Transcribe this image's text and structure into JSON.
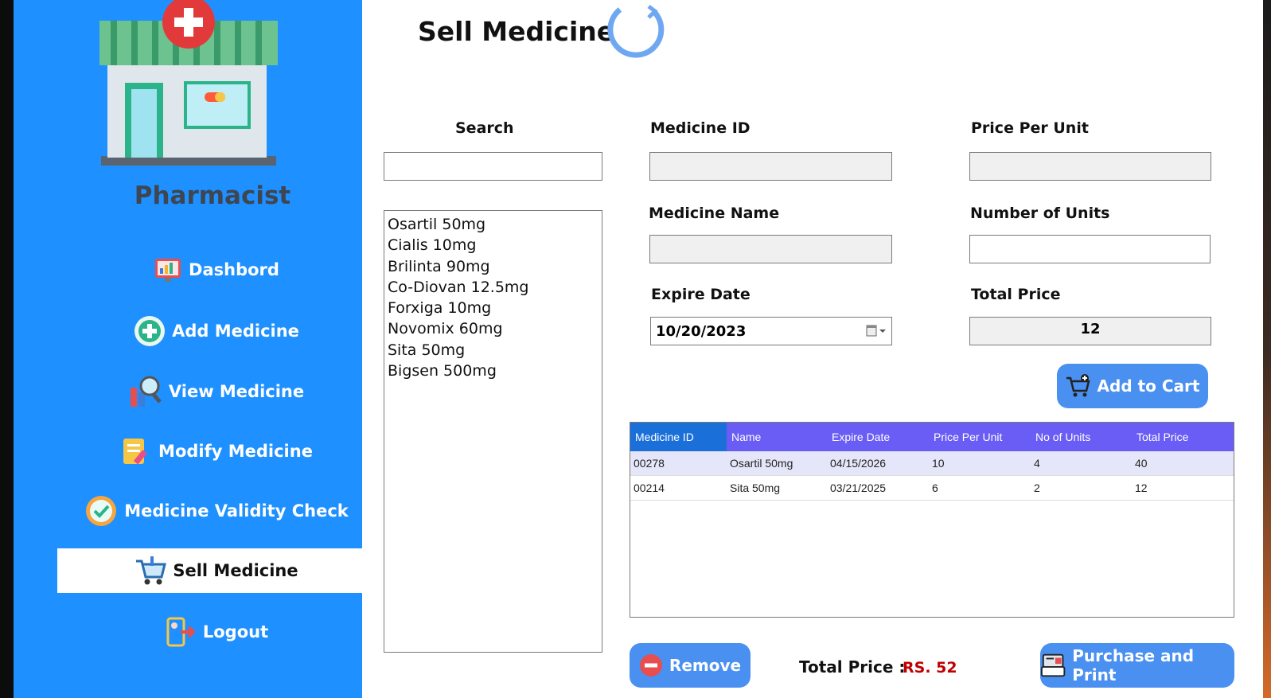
{
  "sidebar": {
    "brand": "Pharmacist",
    "items": [
      {
        "label": "Dashbord",
        "icon": "dashboard-icon"
      },
      {
        "label": "Add Medicine",
        "icon": "add-circle-icon"
      },
      {
        "label": "View Medicine",
        "icon": "magnifier-icon"
      },
      {
        "label": "Modify Medicine",
        "icon": "edit-note-icon"
      },
      {
        "label": "Medicine Validity Check",
        "icon": "check-badge-icon"
      },
      {
        "label": "Sell Medicine",
        "icon": "cart-icon"
      },
      {
        "label": "Logout",
        "icon": "logout-icon"
      }
    ]
  },
  "page": {
    "title": "Sell Medicine"
  },
  "search": {
    "label": "Search",
    "value": ""
  },
  "medicines": [
    "Osartil 50mg",
    "Cialis 10mg",
    "Brilinta 90mg",
    "Co-Diovan 12.5mg",
    "Forxiga 10mg",
    "Novomix 60mg",
    "Sita 50mg",
    "Bigsen 500mg"
  ],
  "form": {
    "medicine_id_label": "Medicine ID",
    "medicine_id": "",
    "price_per_unit_label": "Price Per Unit",
    "price_per_unit": "",
    "medicine_name_label": "Medicine Name",
    "medicine_name": "",
    "units_label": "Number of Units",
    "units": "",
    "expire_label": "Expire Date",
    "expire": "10/20/2023",
    "total_label": "Total Price",
    "total": "12"
  },
  "buttons": {
    "add_to_cart": "Add to Cart",
    "remove": "Remove",
    "purchase": "Purchase and Print"
  },
  "cart": {
    "columns": [
      "Medicine ID",
      "Name",
      "Expire Date",
      "Price Per Unit",
      "No of Units",
      "Total Price"
    ],
    "rows": [
      [
        "00278",
        "Osartil 50mg",
        "04/15/2026",
        "10",
        "4",
        "40"
      ],
      [
        "00214",
        "Sita 50mg",
        "03/21/2025",
        "6",
        "2",
        "12"
      ]
    ]
  },
  "footer": {
    "total_label": "Total Price :",
    "total_value": "RS. 52"
  },
  "colors": {
    "sidebar": "#1e90ff",
    "header": "#6a5df5",
    "button": "#4a90f0",
    "total": "#c00000"
  }
}
